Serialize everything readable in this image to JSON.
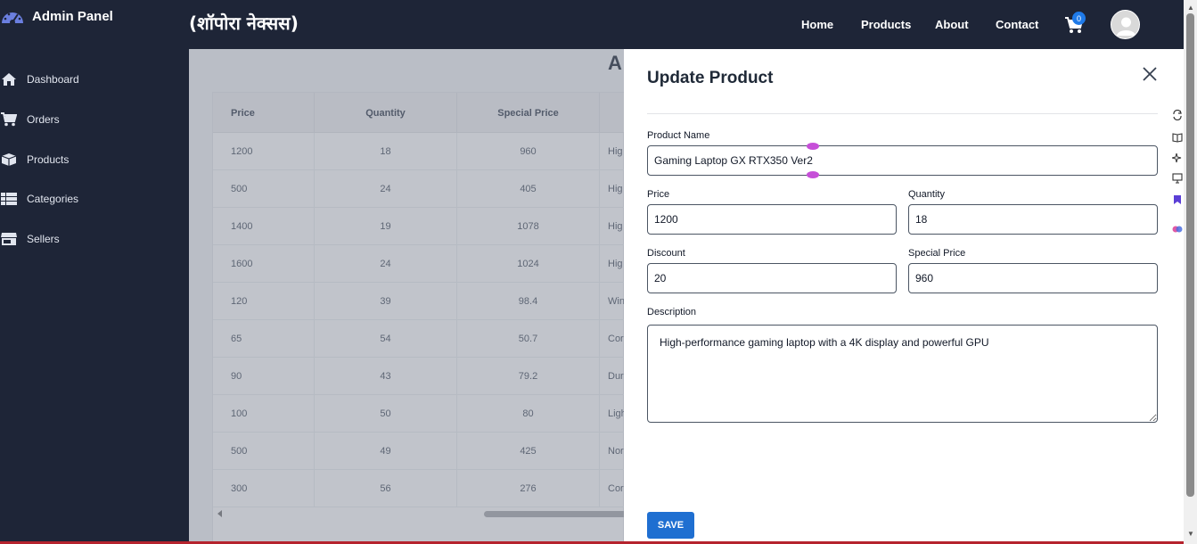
{
  "sidebar": {
    "brand": {
      "title": "Admin Panel",
      "icon": "gauge-icon"
    },
    "items": [
      {
        "label": "Dashboard",
        "icon": "home-icon"
      },
      {
        "label": "Orders",
        "icon": "cart-icon"
      },
      {
        "label": "Products",
        "icon": "boxes-icon"
      },
      {
        "label": "Categories",
        "icon": "grid-list-icon"
      },
      {
        "label": "Sellers",
        "icon": "store-icon"
      }
    ]
  },
  "header": {
    "site_title": "(शॉपोरा नेक्सस)",
    "nav": [
      "Home",
      "Products",
      "About",
      "Contact"
    ],
    "cart_count": "0"
  },
  "main": {
    "heading": "A",
    "columns": [
      "Price",
      "Quantity",
      "Special Price",
      ""
    ],
    "rows": [
      [
        "1200",
        "18",
        "960",
        "Hig"
      ],
      [
        "500",
        "24",
        "405",
        "Hig"
      ],
      [
        "1400",
        "19",
        "1078",
        "Hig"
      ],
      [
        "1600",
        "24",
        "1024",
        "Hig"
      ],
      [
        "120",
        "39",
        "98.4",
        "Win"
      ],
      [
        "65",
        "54",
        "50.7",
        "Cor"
      ],
      [
        "90",
        "43",
        "79.2",
        "Dur"
      ],
      [
        "100",
        "50",
        "80",
        "Ligh"
      ],
      [
        "500",
        "49",
        "425",
        "Nor"
      ],
      [
        "300",
        "56",
        "276",
        "Cor"
      ]
    ]
  },
  "drawer": {
    "title": "Update Product",
    "product_name_label": "Product Name",
    "product_name_value": "Gaming Laptop GX RTX350 Ver2",
    "price_label": "Price",
    "price_value": "1200",
    "quantity_label": "Quantity",
    "quantity_value": "18",
    "discount_label": "Discount",
    "discount_value": "20",
    "special_price_label": "Special Price",
    "special_price_value": "960",
    "description_label": "Description",
    "description_value": "High-performance gaming laptop with a 4K display and powerful GPU",
    "save_label": "SAVE"
  },
  "colors": {
    "sidebar_bg": "#1e2537",
    "accent": "#1f6fd1",
    "badge": "#1f7ae8",
    "handle": "#c64fd8"
  }
}
